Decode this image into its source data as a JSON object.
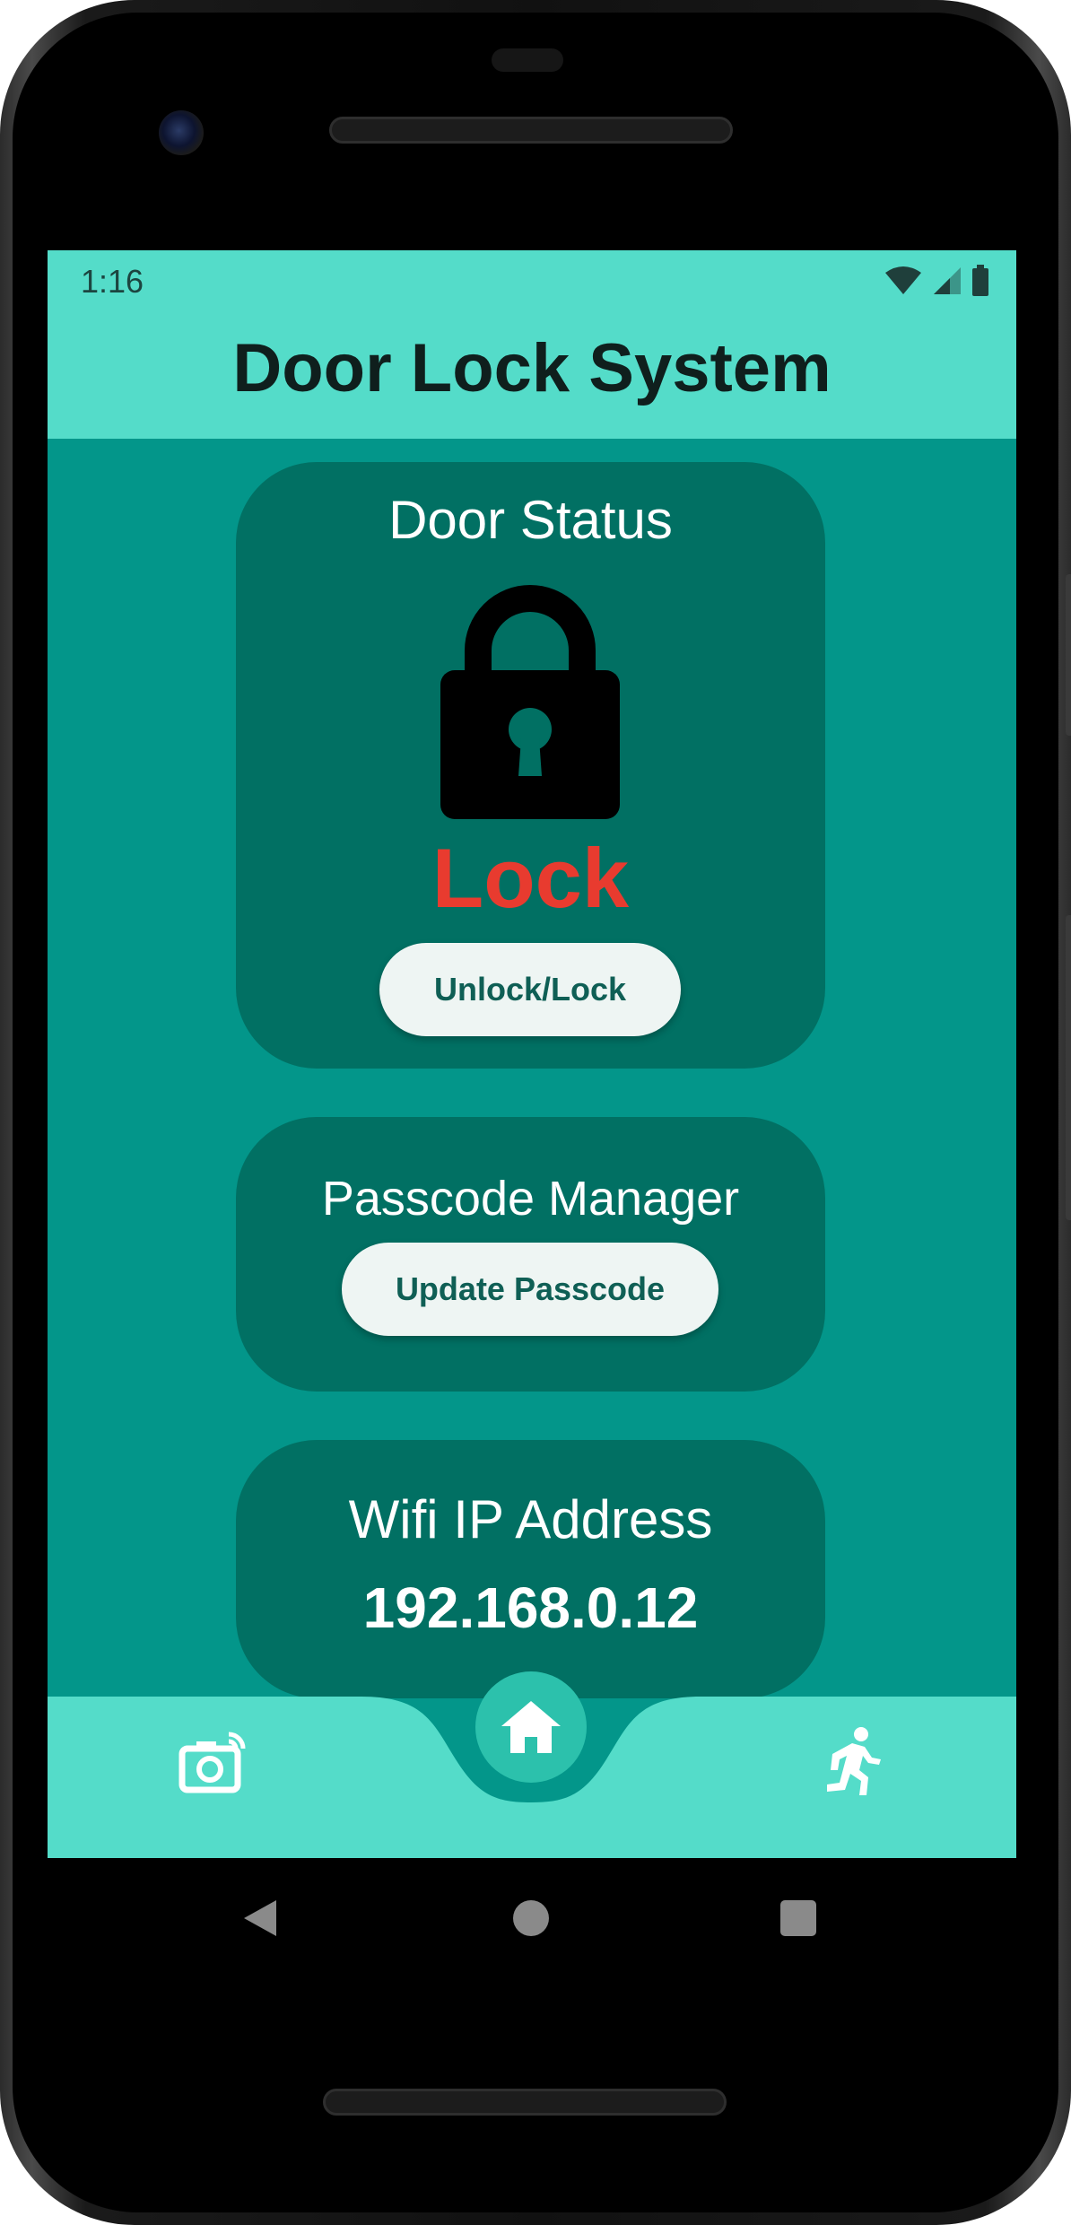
{
  "status_bar": {
    "time": "1:16"
  },
  "header": {
    "title": "Door Lock System"
  },
  "door_card": {
    "title": "Door Status",
    "state_text": "Lock",
    "state_color": "#e83b2f",
    "icon": "lock-icon",
    "button_label": "Unlock/Lock"
  },
  "passcode_card": {
    "title": "Passcode Manager",
    "button_label": "Update Passcode"
  },
  "wifi_card": {
    "title": "Wifi IP Address",
    "ip_value": "192.168.0.12"
  },
  "bottom_nav": {
    "items": [
      {
        "icon": "camera-icon"
      },
      {
        "icon": "home-icon",
        "selected": true
      },
      {
        "icon": "exit-run-icon"
      }
    ]
  },
  "colors": {
    "accent_light": "#54dcc9",
    "background": "#03968a",
    "card": "#017063",
    "button": "#eef5f3"
  }
}
